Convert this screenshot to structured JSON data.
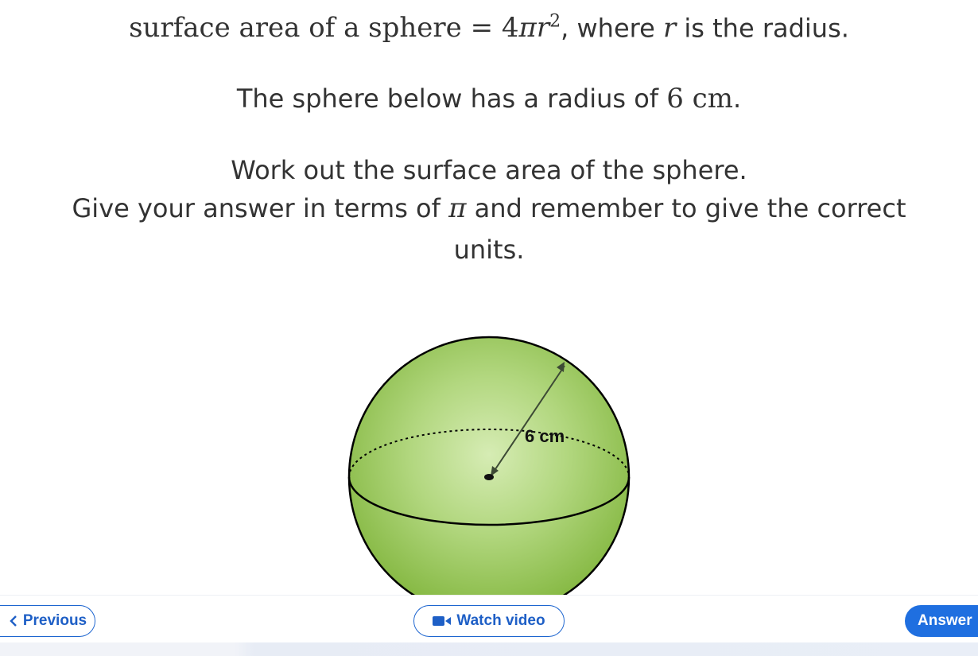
{
  "question": {
    "formula_prefix": "surface area of a sphere = 4",
    "formula_pi": "π",
    "formula_r": "r",
    "formula_exp": "2",
    "formula_suffix_1": ", where ",
    "formula_r2": "r",
    "formula_suffix_2": " is the radius.",
    "radius_text": "The sphere below has a radius of ",
    "radius_value": "6 cm",
    "radius_end": ".",
    "instruction_1": "Work out the surface area of the sphere.",
    "instruction_2_a": "Give your answer in terms of ",
    "instruction_2_pi": "π",
    "instruction_2_b": " and remember to give the correct",
    "instruction_3": "units."
  },
  "diagram": {
    "radius_label": "6 cm",
    "fill_color": "#7fb43a",
    "highlight_color": "#d6ecb4"
  },
  "footer": {
    "previous_label": "Previous",
    "video_label": "Watch video",
    "answer_label": "Answer",
    "accent_color": "#1f6fe0"
  }
}
